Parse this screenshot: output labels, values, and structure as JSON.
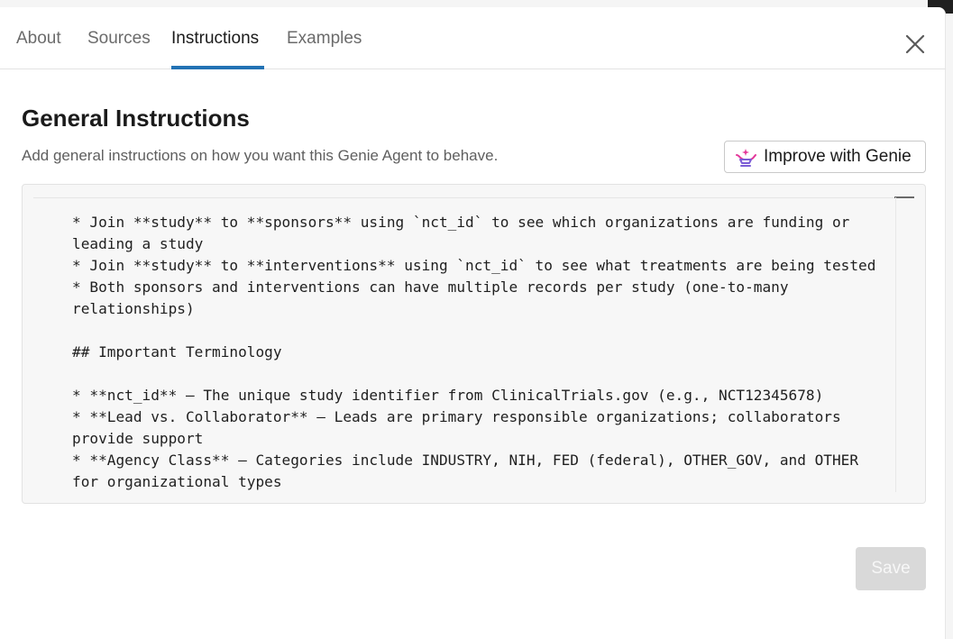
{
  "tabs": [
    {
      "label": "About",
      "active": false
    },
    {
      "label": "Sources",
      "active": false
    },
    {
      "label": "Instructions",
      "active": true
    },
    {
      "label": "Examples",
      "active": false
    }
  ],
  "section": {
    "title": "General Instructions",
    "subtitle": "Add general instructions on how you want this Genie Agent to behave.",
    "improve_button_label": "Improve with Genie"
  },
  "editor": {
    "lines": [
      "* Join **study** to **sponsors** using `nct_id` to see which organizations are funding or",
      "leading a study",
      "* Join **study** to **interventions** using `nct_id` to see what treatments are being tested",
      "* Both sponsors and interventions can have multiple records per study (one-to-many",
      "relationships)",
      "",
      "## Important Terminology",
      "",
      "* **nct_id** – The unique study identifier from ClinicalTrials.gov (e.g., NCT12345678)",
      "* **Lead vs. Collaborator** – Leads are primary responsible organizations; collaborators",
      "provide support",
      "* **Agency Class** – Categories include INDUSTRY, NIH, FED (federal), OTHER_GOV, and OTHER",
      "for organizational types"
    ]
  },
  "footer": {
    "save_label": "Save",
    "save_enabled": false
  },
  "colors": {
    "accent": "#2272b4",
    "genie_icon_primary": "#e4389a",
    "genie_icon_secondary": "#7b5cd6",
    "save_disabled_bg": "#d9d9d9"
  },
  "icons": {
    "close": "close-icon",
    "genie": "genie-lamp-icon"
  }
}
